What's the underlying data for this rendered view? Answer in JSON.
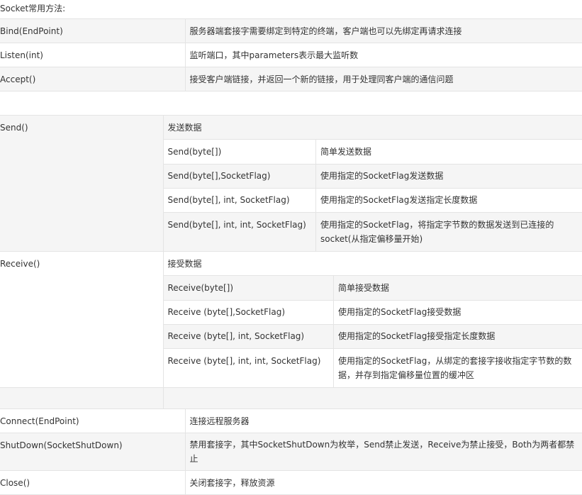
{
  "title": "Socket常用方法:",
  "basic_methods": [
    {
      "method": "Bind(EndPoint)",
      "desc": "服务器端套接字需要绑定到特定的终端，客户端也可以先绑定再请求连接"
    },
    {
      "method": "Listen(int)",
      "desc": "监听端口，其中parameters表示最大监听数"
    },
    {
      "method": "Accept()",
      "desc": "接受客户端链接，并返回一个新的链接，用于处理同客户端的通信问题"
    }
  ],
  "send": {
    "method": "Send()",
    "summary": "发送数据",
    "overloads": [
      {
        "sig": "Send(byte[])",
        "desc": "简单发送数据"
      },
      {
        "sig": "Send(byte[],SocketFlag)",
        "desc": "使用指定的SocketFlag发送数据"
      },
      {
        "sig": "Send(byte[], int, SocketFlag)",
        "desc": "使用指定的SocketFlag发送指定长度数据"
      },
      {
        "sig": "Send(byte[], int, int, SocketFlag)",
        "desc": "使用指定的SocketFlag，将指定字节数的数据发送到已连接的socket(从指定偏移量开始)"
      }
    ]
  },
  "receive": {
    "method": "Receive()",
    "summary": "接受数据",
    "overloads": [
      {
        "sig": "Receive(byte[])",
        "desc": "简单接受数据"
      },
      {
        "sig": "Receive (byte[],SocketFlag)",
        "desc": "使用指定的SocketFlag接受数据"
      },
      {
        "sig": "Receive (byte[], int, SocketFlag)",
        "desc": "使用指定的SocketFlag接受指定长度数据"
      },
      {
        "sig": "Receive (byte[], int, int, SocketFlag)",
        "desc": "使用指定的SocketFlag，从绑定的套接字接收指定字节数的数据，并存到指定偏移量位置的缓冲区"
      }
    ]
  },
  "other_methods": [
    {
      "method": "Connect(EndPoint)",
      "desc": "连接远程服务器"
    },
    {
      "method": "ShutDown(SocketShutDown)",
      "desc": "禁用套接字，其中SocketShutDown为枚举，Send禁止发送，Receive为禁止接受，Both为两者都禁止"
    },
    {
      "method": "Close()",
      "desc": "关闭套接字，释放资源"
    }
  ]
}
